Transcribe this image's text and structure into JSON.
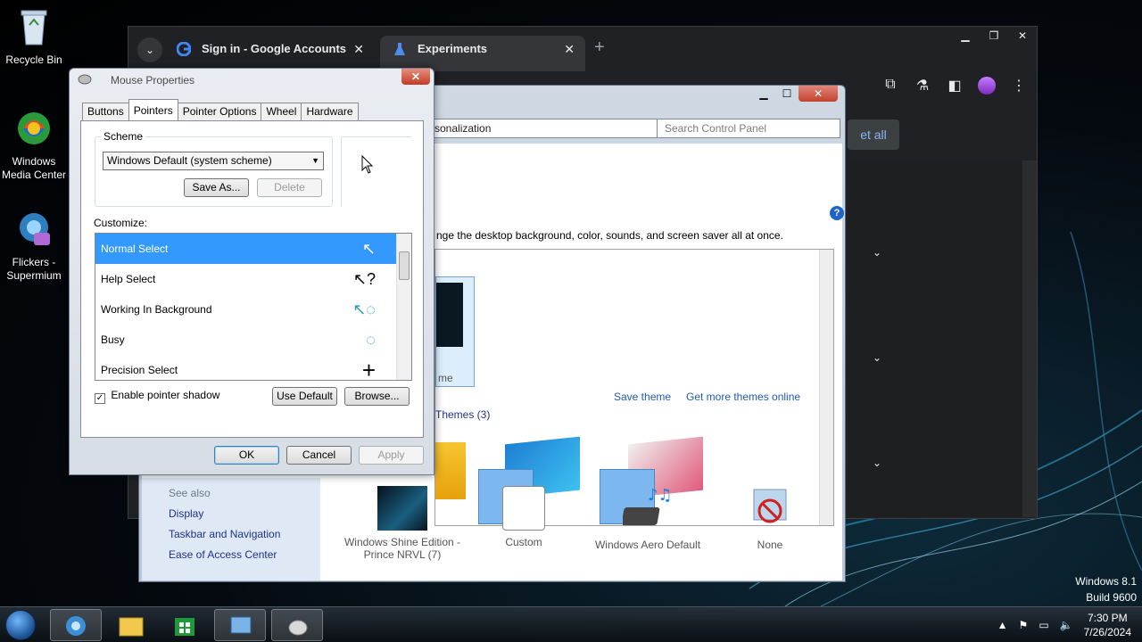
{
  "desktop": {
    "icons": [
      {
        "label": "Recycle Bin",
        "icon": "recycle-bin-icon"
      },
      {
        "label": "Windows Media Center",
        "icon": "media-center-icon"
      },
      {
        "label": "Flickers - Supermium",
        "icon": "supermium-icon"
      }
    ],
    "watermark": {
      "line1": "Windows 8.1",
      "line2": "Build 9600"
    }
  },
  "chrome": {
    "tabs": [
      {
        "title": "Sign in - Google Accounts",
        "icon": "google-icon"
      },
      {
        "title": "Experiments",
        "icon": "flask-icon"
      }
    ],
    "new_tab": "+",
    "set_all_label": "et all"
  },
  "control_panel": {
    "address": "sonalization",
    "search_placeholder": "Search Control Panel",
    "description": "nge the desktop background, color, sounds, and screen saver all at once.",
    "theme_label_partial": "me",
    "save_theme": "Save theme",
    "get_more_themes": "Get more themes online",
    "installed_themes": "Themes (3)",
    "see_also": "See also",
    "side_links": [
      "Display",
      "Taskbar and Navigation",
      "Ease of Access Center"
    ],
    "bottom_items": [
      {
        "label": "Windows Shine Edition - Prince NRVL (7)",
        "icon": "desktop-background-icon"
      },
      {
        "label": "Custom",
        "icon": "custom-color-icon"
      },
      {
        "label": "Windows Aero Default",
        "icon": "sounds-icon"
      },
      {
        "label": "None",
        "icon": "screensaver-none-icon"
      }
    ]
  },
  "mouse_properties": {
    "title": "Mouse Properties",
    "close_label": "✕",
    "tabs": [
      "Buttons",
      "Pointers",
      "Pointer Options",
      "Wheel",
      "Hardware"
    ],
    "active_tab": "Pointers",
    "scheme_label": "Scheme",
    "scheme_value": "Windows Default (system scheme)",
    "save_as": "Save As...",
    "delete": "Delete",
    "customize_label": "Customize:",
    "cursors": [
      {
        "name": "Normal Select",
        "glyph": "↖",
        "selected": true
      },
      {
        "name": "Help Select",
        "glyph": "↖?",
        "selected": false
      },
      {
        "name": "Working In Background",
        "glyph": "↖◌",
        "selected": false
      },
      {
        "name": "Busy",
        "glyph": "◌",
        "selected": false
      },
      {
        "name": "Precision Select",
        "glyph": "+",
        "selected": false
      }
    ],
    "enable_shadow": "Enable pointer shadow",
    "shadow_checked": "✓",
    "use_default": "Use Default",
    "browse": "Browse...",
    "ok": "OK",
    "cancel": "Cancel",
    "apply": "Apply"
  },
  "taskbar": {
    "apps": [
      "internet-explorer-icon",
      "file-explorer-icon",
      "store-icon",
      "control-panel-icon",
      "mouse-icon"
    ],
    "time": "7:30 PM",
    "date": "7/26/2024",
    "tray_icons": [
      "show-hidden-icon",
      "flag-icon",
      "network-icon",
      "volume-icon"
    ]
  },
  "colors": {
    "selection": "#3399ff",
    "link": "#1e5bb4",
    "chrome_bg": "#202124"
  }
}
